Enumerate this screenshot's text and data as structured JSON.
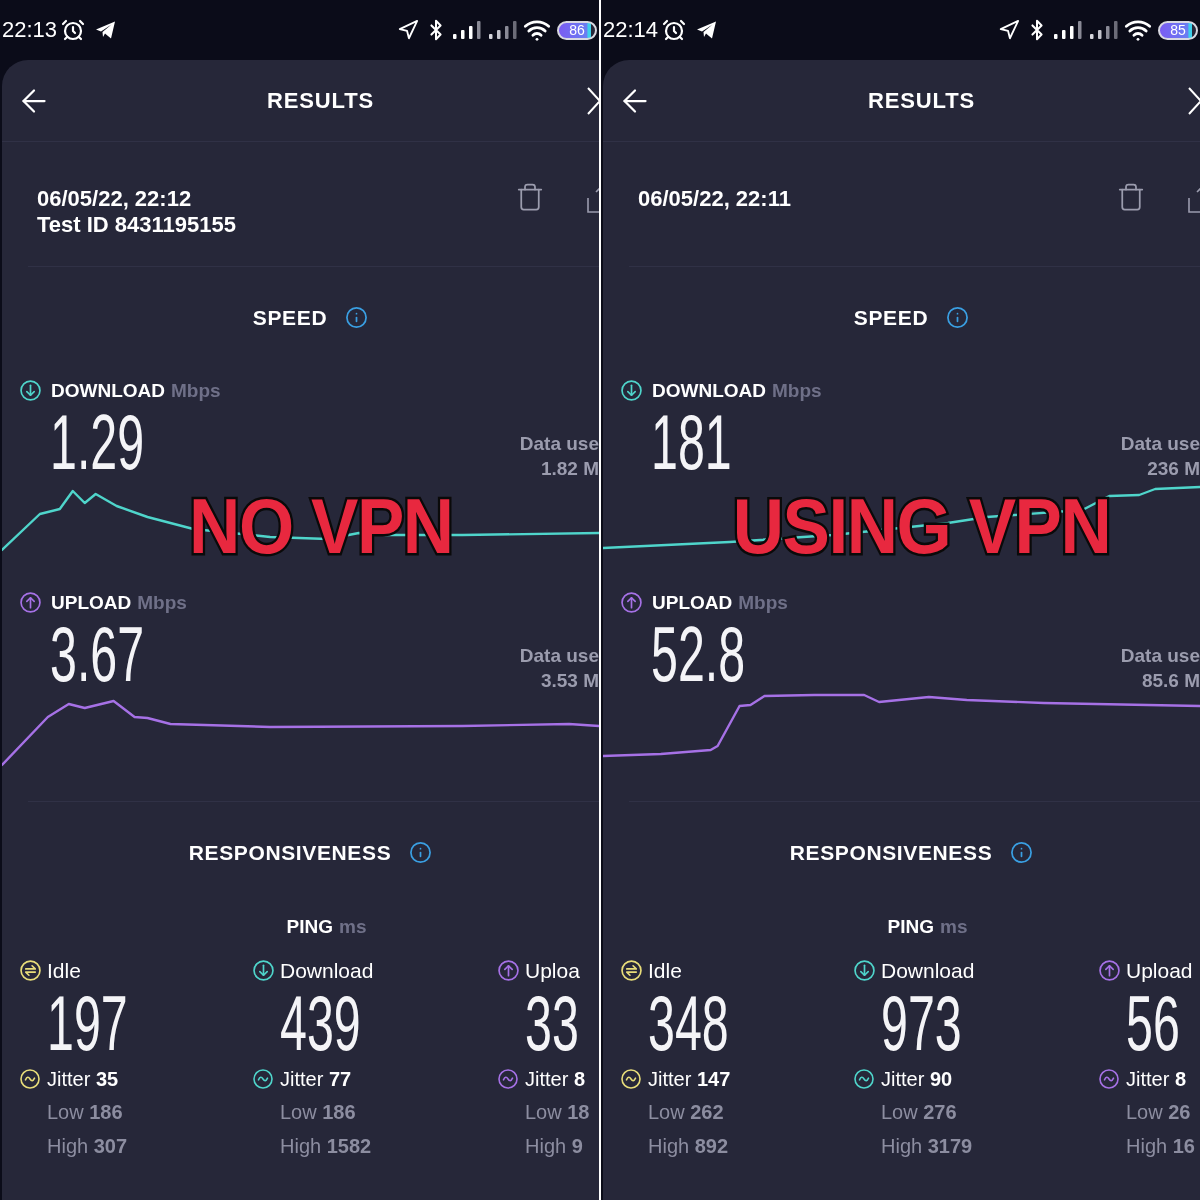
{
  "panels": [
    {
      "overlay_label": "NO VPN",
      "status_bar": {
        "time": "22:13",
        "battery": "86"
      },
      "header": {
        "title": "RESULTS"
      },
      "test": {
        "date": "06/05/22, 22:12",
        "test_id": "Test ID 8431195155"
      },
      "speed": {
        "title": "SPEED",
        "metrics": [
          {
            "kind": "download",
            "label": "DOWNLOAD",
            "unit": "Mbps",
            "value": "1.29",
            "data_used_label": "Data use",
            "data_used": "1.82 M"
          },
          {
            "kind": "upload",
            "label": "UPLOAD",
            "unit": "Mbps",
            "value": "3.67",
            "data_used_label": "Data use",
            "data_used": "3.53 M"
          }
        ]
      },
      "responsiveness": {
        "title": "RESPONSIVENESS",
        "ping_label": "PING",
        "ping_unit": "ms",
        "columns": [
          {
            "kind": "idle",
            "label": "Idle",
            "value": "197",
            "jitter": "Jitter **35**",
            "low": "Low **186**",
            "high": "High **307**"
          },
          {
            "kind": "download",
            "label": "Download",
            "value": "439",
            "jitter": "Jitter **77**",
            "low": "Low **186**",
            "high": "High **1582**"
          },
          {
            "kind": "upload",
            "label": "Uploa",
            "value": "33",
            "jitter": "Jitter **8**",
            "low": "Low **18**",
            "high": "High **9**"
          }
        ]
      }
    },
    {
      "overlay_label": "USING VPN",
      "status_bar": {
        "time": "22:14",
        "battery": "85"
      },
      "header": {
        "title": "RESULTS"
      },
      "test": {
        "date": "06/05/22, 22:11"
      },
      "speed": {
        "title": "SPEED",
        "metrics": [
          {
            "kind": "download",
            "label": "DOWNLOAD",
            "unit": "Mbps",
            "value": "181",
            "data_used_label": "Data use",
            "data_used": "236 M"
          },
          {
            "kind": "upload",
            "label": "UPLOAD",
            "unit": "Mbps",
            "value": "52.8",
            "data_used_label": "Data use",
            "data_used": "85.6 M"
          }
        ]
      },
      "responsiveness": {
        "title": "RESPONSIVENESS",
        "ping_label": "PING",
        "ping_unit": "ms",
        "columns": [
          {
            "kind": "idle",
            "label": "Idle",
            "value": "348",
            "jitter": "Jitter **147**",
            "low": "Low **262**",
            "high": "High **892**"
          },
          {
            "kind": "download",
            "label": "Download",
            "value": "973",
            "jitter": "Jitter **90**",
            "low": "Low **276**",
            "high": "High **3179**"
          },
          {
            "kind": "upload",
            "label": "Upload",
            "value": "56",
            "jitter": "Jitter **8**",
            "low": "Low **26**",
            "high": "High **16**"
          }
        ]
      }
    }
  ]
}
